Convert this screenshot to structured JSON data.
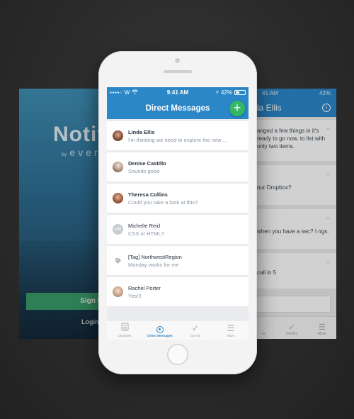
{
  "left_screen": {
    "title": "Notif",
    "by_label": "by",
    "by_brand": "ever",
    "signup_label": "Sign Up",
    "login_label": "Login"
  },
  "right_screen": {
    "status_battery": "42%",
    "status_time": "41 AM",
    "header_title": "da Ellis",
    "cards": [
      {
        "text": "anged a few things in it's ready to go now. to list with only two items."
      },
      {
        "text": "our Dropbox?"
      },
      {
        "text": "when you have a sec? I ngs."
      },
      {
        "text": "call in 5"
      }
    ],
    "tabs": [
      "es",
      "Got-It's",
      "More"
    ]
  },
  "status_bar": {
    "carrier": "W",
    "time": "9:41 AM",
    "battery": "42%"
  },
  "nav": {
    "title": "Direct Messages",
    "compose_label": "+"
  },
  "messages": [
    {
      "name": "Linda Ellis",
      "preview": "I'm thinking we need to explore the new ...",
      "avatar": "photo",
      "bold": true
    },
    {
      "name": "Denise Castillo",
      "preview": "Sounds good",
      "avatar": "photo2",
      "bold": true
    },
    {
      "name": "Theresa Collins",
      "preview": "Could you take a look at this?",
      "avatar": "photo3",
      "bold": true
    },
    {
      "name": "Michelle Reid",
      "preview": "CSS or HTML?",
      "avatar": "initials",
      "initials": "MR",
      "bold": false
    },
    {
      "name": "[Tag] NorthwestRegion",
      "preview": "Monday works for me",
      "avatar": "tag",
      "bold": false
    },
    {
      "name": "Rachel Porter",
      "preview": "Yes!!!",
      "avatar": "photo4",
      "bold": false
    }
  ],
  "tabbar": {
    "tabs": [
      {
        "label": "Channels",
        "icon": "channels-icon",
        "active": false
      },
      {
        "label": "Direct Messages",
        "icon": "user-circle-icon",
        "active": true
      },
      {
        "label": "Got-It's",
        "icon": "checkmark-icon",
        "active": false
      },
      {
        "label": "More",
        "icon": "menu-icon",
        "active": false
      }
    ]
  },
  "colors": {
    "primary_blue": "#2b87c8",
    "compose_green": "#33b766"
  }
}
